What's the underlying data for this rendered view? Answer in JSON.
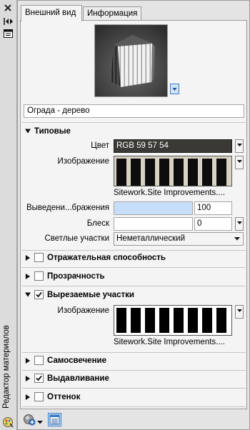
{
  "palette": {
    "title": "Редактор материалов"
  },
  "tabs": [
    {
      "label": "Внешний вид"
    },
    {
      "label": "Информация"
    }
  ],
  "material_name": "Ограда - дерево",
  "sections": {
    "generic": {
      "label": "Типовые",
      "color_label": "Цвет",
      "color_value": "RGB 59 57 54",
      "image_label": "Изображение",
      "image_caption": "Sitework.Site Improvements....",
      "fade_label": "Выведени...бражения",
      "fade_value": "100",
      "gloss_label": "Блеск",
      "gloss_value": "0",
      "highlights_label": "Светлые участки",
      "highlights_value": "Неметаллический"
    },
    "reflectivity": {
      "label": "Отражательная способность"
    },
    "transparency": {
      "label": "Прозрачность"
    },
    "cutouts": {
      "label": "Вырезаемые участки",
      "image_label": "Изображение",
      "image_caption": "Sitework.Site Improvements...."
    },
    "self_illumination": {
      "label": "Самосвечение"
    },
    "bump": {
      "label": "Выдавливание"
    },
    "tint": {
      "label": "Оттенок"
    }
  },
  "colors": {
    "color_swatch": "#3b3936",
    "fade_bar": "#c7defa",
    "accent": "#3a7ecf"
  }
}
